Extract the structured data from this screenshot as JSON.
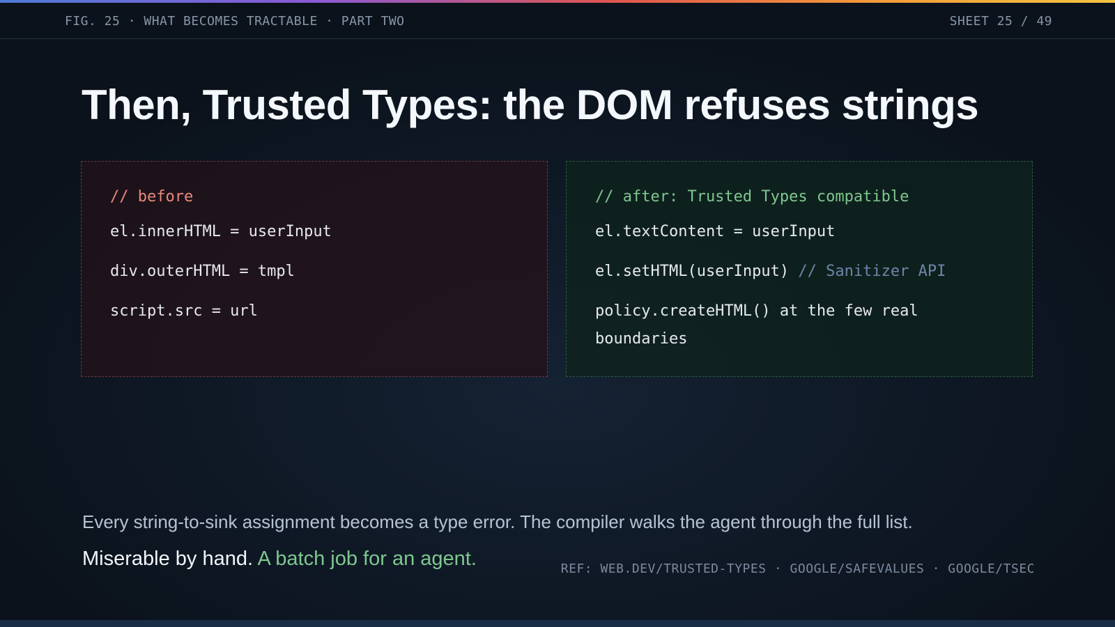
{
  "header": {
    "figure_label": "FIG. 25 · WHAT BECOMES TRACTABLE · PART TWO",
    "sheet_label": "SHEET 25 / 49"
  },
  "title": "Then, Trusted Types: the DOM refuses strings",
  "before_panel": {
    "comment": "// before",
    "lines": [
      "el.innerHTML = userInput",
      "div.outerHTML = tmpl",
      "script.src = url"
    ]
  },
  "after_panel": {
    "comment": "// after: Trusted Types compatible",
    "lines": [
      {
        "code": "el.textContent = userInput",
        "comment": ""
      },
      {
        "code": "el.setHTML(userInput) ",
        "comment": "// Sanitizer API"
      },
      {
        "code": "policy.createHTML() at the few real boundaries",
        "comment": ""
      }
    ]
  },
  "footer": {
    "line1": "Every string-to-sink assignment becomes a type error. The compiler walks the agent through the full list.",
    "line2_plain": "Miserable by hand. ",
    "line2_accent": "A batch job for an agent.",
    "reference": "REF: WEB.DEV/TRUSTED-TYPES · GOOGLE/SAFEVALUES · GOOGLE/TSEC"
  },
  "colors": {
    "before_border": "#6b3a41",
    "after_border": "#2f5a45",
    "before_comment": "#e88a7c",
    "after_comment": "#7fc78f",
    "accent_green": "#7fc78f"
  }
}
